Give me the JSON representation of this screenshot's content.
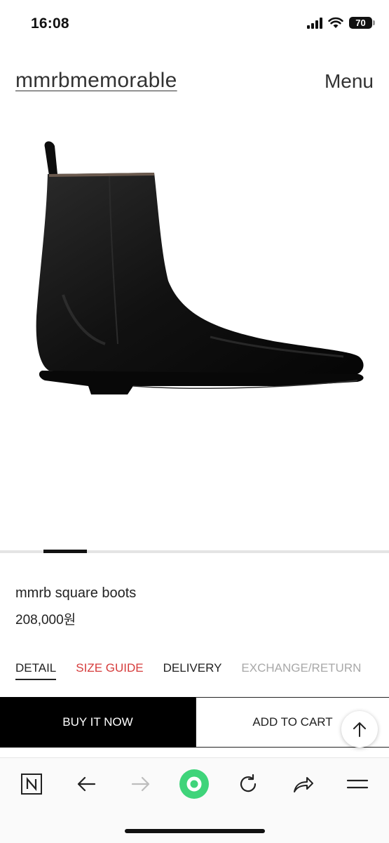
{
  "status_bar": {
    "time": "16:08",
    "battery_level": "70",
    "icons": [
      "signal-icon",
      "wifi-icon",
      "battery-icon"
    ]
  },
  "header": {
    "brand": "mmrbmemorable",
    "menu_label": "Menu"
  },
  "product": {
    "image_icon": "ankle-boot-image",
    "name": "mmrb square boots",
    "price": "208,000원"
  },
  "tabs": [
    {
      "label": "DETAIL",
      "state": "active"
    },
    {
      "label": "SIZE GUIDE",
      "state": "highlight"
    },
    {
      "label": "DELIVERY",
      "state": "normal"
    },
    {
      "label": "EXCHANGE/RETURN",
      "state": "muted"
    }
  ],
  "actions": {
    "buy_label": "BUY IT NOW",
    "cart_label": "ADD TO CART",
    "scroll_top_icon": "arrow-up-icon"
  },
  "browser_toolbar": {
    "icons": [
      "naver-n-icon",
      "back-arrow-icon",
      "forward-arrow-icon",
      "green-dot-icon",
      "refresh-icon",
      "share-icon",
      "menu-lines-icon"
    ]
  },
  "colors": {
    "accent_red": "#d63c3c",
    "muted_gray": "#a8a8a8",
    "green_dot": "#3fd47a",
    "primary_black": "#000000"
  }
}
